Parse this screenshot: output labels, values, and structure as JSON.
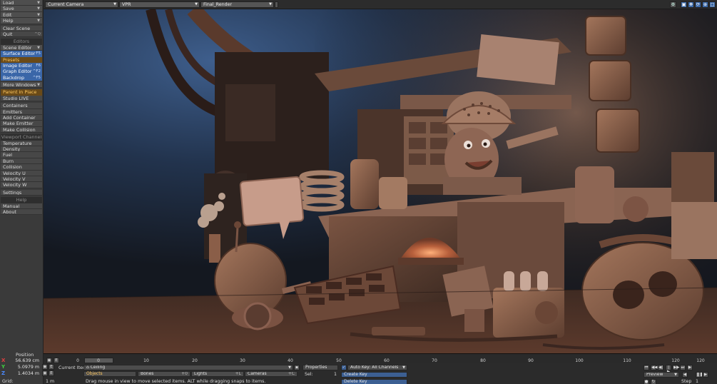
{
  "sidebar": {
    "menus": [
      {
        "label": "Load"
      },
      {
        "label": "Save"
      },
      {
        "label": "Edit"
      },
      {
        "label": "Help"
      }
    ],
    "file_items": [
      {
        "label": "Clear Scene",
        "shortcut": ""
      },
      {
        "label": "Quit",
        "shortcut": "^Q"
      }
    ],
    "editors_header": "Editors",
    "editors": [
      {
        "label": "Scene Editor",
        "shortcut": ""
      },
      {
        "label": "Surface Editor",
        "shortcut": "F5"
      }
    ],
    "presets": "Presets",
    "editors2": [
      {
        "label": "Image Editor",
        "shortcut": "F6"
      },
      {
        "label": "Graph Editor",
        "shortcut": "^F2"
      },
      {
        "label": "Backdrop",
        "shortcut": "^F5"
      }
    ],
    "more_windows": "More Windows",
    "parent_in_place": "Parent in Place",
    "studio_live": "Studio LIVE",
    "containers": [
      {
        "label": "Containers"
      },
      {
        "label": "Emitters"
      },
      {
        "label": "Add Container"
      },
      {
        "label": "Make Emitter"
      },
      {
        "label": "Make Collision"
      }
    ],
    "viewport_channel_header": "Viewport Channel",
    "channels": [
      {
        "label": "Temperature"
      },
      {
        "label": "Density"
      },
      {
        "label": "Fuel"
      },
      {
        "label": "Burn"
      },
      {
        "label": "Collision"
      },
      {
        "label": "Velocity U"
      },
      {
        "label": "Velocity V"
      },
      {
        "label": "Velocity W"
      }
    ],
    "settings": "Settings",
    "help_header": "Help",
    "help_items": [
      {
        "label": "Manual"
      },
      {
        "label": "About"
      }
    ]
  },
  "topbar": {
    "camera_select": "Current Camera",
    "render_mode": "VPR",
    "render_preset": "Final_Render"
  },
  "timeline": {
    "ticks": [
      "0",
      "10",
      "20",
      "30",
      "40",
      "50",
      "60",
      "70",
      "80",
      "90",
      "100",
      "110",
      "120"
    ],
    "end_frame": "120"
  },
  "bottom": {
    "position_label": "Position",
    "x_label": "X",
    "y_label": "Y",
    "z_label": "Z",
    "x_value": "56.639 cm",
    "y_value": "5.0979 m",
    "z_value": "1.4034 m",
    "frame_zero": "0",
    "grid_label": "Grid:",
    "grid_value": "1 m",
    "current_item_label": "Current Item",
    "current_item": "Ceiling",
    "objects_tab": "Objects",
    "bones_tab": "Bones",
    "lights_tab": "Lights",
    "cameras_tab": "Cameras",
    "properties": "Properties",
    "sel_label": "Sel:",
    "sel_value": "1",
    "auto_key": "Auto Key: All Channels",
    "create_key": "Create Key",
    "delete_key": "Delete Key",
    "preview": "Preview",
    "step_label": "Step",
    "step_value": "1",
    "status": "Drag mouse in view to move selected items. ALT while dragging snaps to items."
  },
  "colors": {
    "selected": "#3a66a8",
    "highlight": "#ffc860",
    "axis_x": "#e04040",
    "axis_y": "#40d040",
    "axis_z": "#4a8aff"
  }
}
